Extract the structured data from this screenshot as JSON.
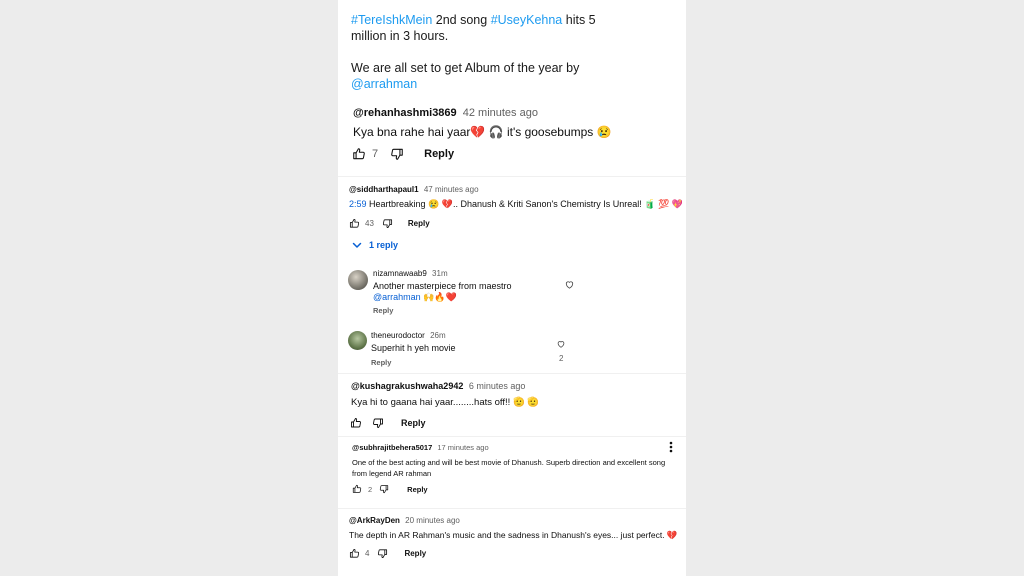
{
  "post": {
    "tag1": "#TereIshkMein",
    "mid1": " 2nd song ",
    "tag2": "#UseyKehna",
    "mid2": " hits 5",
    "line2": "million in 3 hours.",
    "line3": "We are all set to get Album of the year by",
    "mention": "@arrahman"
  },
  "comments": [
    {
      "user": "@rehanhashmi3869",
      "time": "42 minutes ago",
      "text": "Kya bna rahe hai yaar💔 🎧 it's goosebumps 😢",
      "likes": "7",
      "reply": "Reply"
    },
    {
      "user": "@siddharthapaul1",
      "time": "47 minutes ago",
      "timestamp": "2:59",
      "text": " Heartbreaking 😢 💔.. Dhanush & Kriti Sanon's Chemistry Is Unreal! 🧃 💯 💖",
      "likes": "43",
      "reply": "Reply",
      "replies_toggle": "1 reply",
      "replies": [
        {
          "user": "nizamnawaab9",
          "time": "31m",
          "text": "Another masterpiece from maestro",
          "mention": "@arrahman",
          "emoji": " 🙌🔥❤️",
          "reply": "Reply"
        },
        {
          "user": "theneurodoctor",
          "time": "26m",
          "text": "Superhit h yeh movie",
          "likes": "2",
          "reply": "Reply"
        }
      ]
    },
    {
      "user": "@kushagrakushwaha2942",
      "time": "6 minutes ago",
      "text": "Kya hi to gaana hai yaar........hats off!! 🫡 🫡",
      "reply": "Reply"
    },
    {
      "user": "@subhrajitbehera5017",
      "time": "17 minutes ago",
      "text1": "One of the best acting and will be best movie of Dhanush. Superb direction and excellent song",
      "text2": "from legend AR rahman",
      "likes": "2",
      "reply": "Reply"
    },
    {
      "user": "@ArkRayDen",
      "time": "20 minutes ago",
      "text": "The depth in AR Rahman's music and the sadness in Dhanush's eyes... just perfect. 💔",
      "likes": "4",
      "reply": "Reply"
    }
  ],
  "icons": [
    "thumb-up-icon",
    "thumb-down-icon",
    "chevron-down-icon",
    "heart-outline-icon",
    "more-vert-icon"
  ],
  "colors": {
    "link": "#065fd4",
    "hashtag": "#1d9bf0",
    "page_bg": "#ececec"
  }
}
